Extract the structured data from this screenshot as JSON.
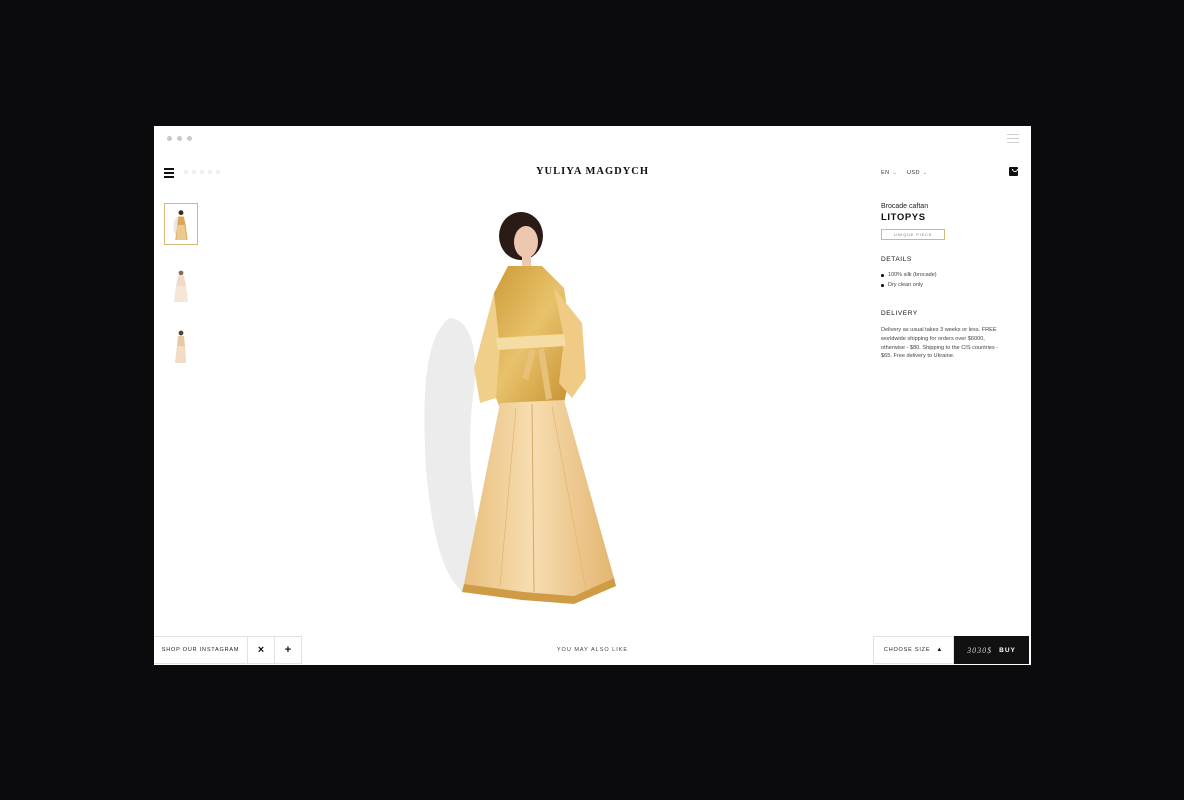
{
  "header": {
    "brand": "YULIYA MAGDYCH",
    "language": "EN",
    "currency": "USD"
  },
  "thumbnails": [
    {
      "name": "thumbnail-front"
    },
    {
      "name": "thumbnail-back"
    },
    {
      "name": "thumbnail-side"
    }
  ],
  "product": {
    "subtitle": "Brocade caftan",
    "name": "LITOPYS",
    "badge": "UNIQUE PIECE"
  },
  "details": {
    "title": "DETAILS",
    "items": [
      "100% silk (brocade)",
      "Dry clean only"
    ]
  },
  "delivery": {
    "title": "DELIVERY",
    "text": "Delivery as usual takes 3 weeks or less. FREE worldwide shipping for orders over $6000, otherwise - $80. Shipping to the CIS countries - $65. Free delivery to Ukraine."
  },
  "bottom": {
    "instagram": "SHOP OUR INSTAGRAM",
    "close": "×",
    "plus": "+",
    "you_may_also_like": "YOU MAY ALSO LIKE",
    "choose_size": "CHOOSE SIZE",
    "price": "3030$",
    "buy": "BUY"
  },
  "icons": {
    "menu": "hamburger-icon",
    "cart": "bag-icon",
    "caret": "caret-up-icon",
    "chevron": "chevron-down-icon"
  },
  "colors": {
    "accent_gold": "#d6b878",
    "dark": "#111111",
    "background": "#0b0b0d"
  }
}
